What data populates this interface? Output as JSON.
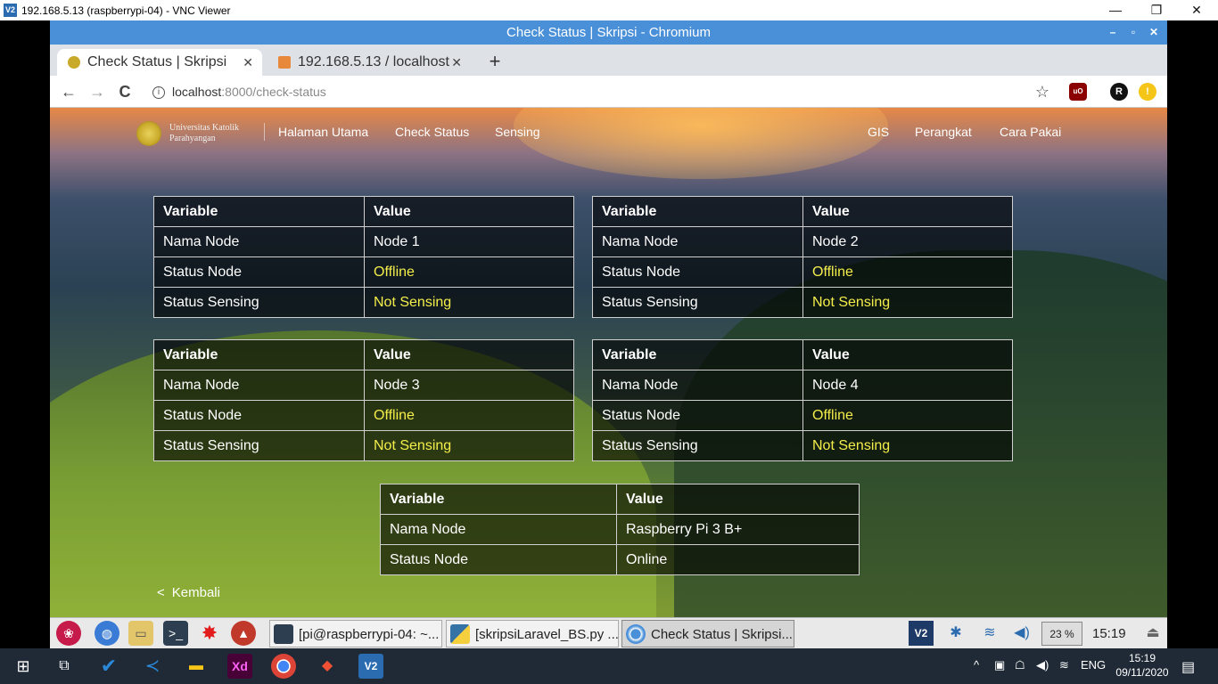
{
  "vnc": {
    "title": "192.168.5.13 (raspberrypi-04) - VNC Viewer",
    "logo": "V2",
    "minimize": "—",
    "maximize": "❐",
    "close": "✕"
  },
  "browser": {
    "window_title": "Check Status | Skripsi - Chromium",
    "tabs": [
      {
        "label": "Check Status | Skripsi",
        "active": true,
        "close": "✕"
      },
      {
        "label": "192.168.5.13 / localhost",
        "active": false,
        "close": "✕"
      }
    ],
    "new_tab": "+",
    "url_host": "localhost",
    "url_path": ":8000/check-status",
    "nav": {
      "back": "←",
      "forward": "→",
      "reload": "C"
    },
    "icons": {
      "star": "☆",
      "ublock": "uO",
      "ext_r": "R",
      "ext_y": "!"
    }
  },
  "site": {
    "logo_text_line1": "Universitas Katolik",
    "logo_text_line2": "Parahyangan",
    "nav_left": [
      "Halaman Utama",
      "Check Status",
      "Sensing"
    ],
    "nav_right": [
      "GIS",
      "Perangkat",
      "Cara Pakai"
    ]
  },
  "tables": [
    {
      "h1": "Variable",
      "h2": "Value",
      "rows": [
        [
          "Nama Node",
          "Node 1"
        ],
        [
          "Status Node",
          "Offline"
        ],
        [
          "Status Sensing",
          "Not Sensing"
        ]
      ]
    },
    {
      "h1": "Variable",
      "h2": "Value",
      "rows": [
        [
          "Nama Node",
          "Node 2"
        ],
        [
          "Status Node",
          "Offline"
        ],
        [
          "Status Sensing",
          "Not Sensing"
        ]
      ]
    },
    {
      "h1": "Variable",
      "h2": "Value",
      "rows": [
        [
          "Nama Node",
          "Node 3"
        ],
        [
          "Status Node",
          "Offline"
        ],
        [
          "Status Sensing",
          "Not Sensing"
        ]
      ]
    },
    {
      "h1": "Variable",
      "h2": "Value",
      "rows": [
        [
          "Nama Node",
          "Node 4"
        ],
        [
          "Status Node",
          "Offline"
        ],
        [
          "Status Sensing",
          "Not Sensing"
        ]
      ]
    },
    {
      "h1": "Variable",
      "h2": "Value",
      "rows": [
        [
          "Nama Node",
          "Raspberry Pi 3 B+"
        ],
        [
          "Status Node",
          "Online"
        ]
      ]
    }
  ],
  "back_link": "Kembali",
  "pi_taskbar": {
    "tasks": [
      "[pi@raspberrypi-04: ~...",
      "[skripsiLaravel_BS.py ...",
      "Check Status | Skripsi..."
    ],
    "cpu": "23 %",
    "time": "15:19"
  },
  "windows": {
    "lang": "ENG",
    "time": "15:19",
    "date": "09/11/2020"
  },
  "colors": {
    "highlight": "#f4ee4a",
    "chromium_title": "#4a90d9"
  }
}
